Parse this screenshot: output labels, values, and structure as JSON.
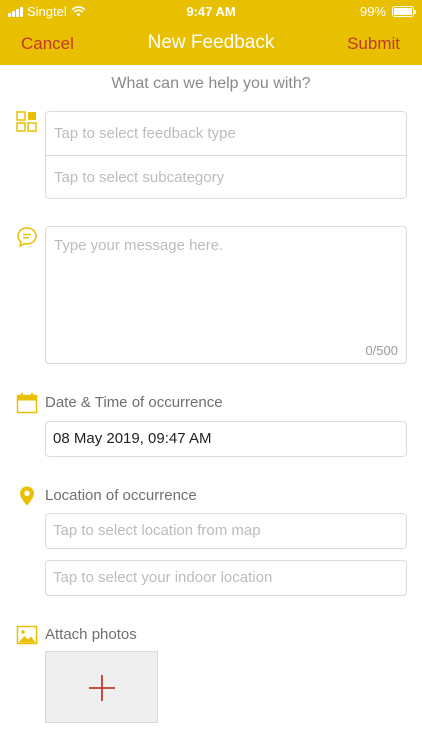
{
  "status_bar": {
    "carrier": "Singtel",
    "time": "9:47 AM",
    "battery": "99%"
  },
  "nav": {
    "cancel_label": "Cancel",
    "title": "New Feedback",
    "submit_label": "Submit"
  },
  "prompt": "What can we help you with?",
  "feedback_type": {
    "type_placeholder": "Tap to select feedback type",
    "subcategory_placeholder": "Tap to select subcategory"
  },
  "message": {
    "placeholder": "Type your message here.",
    "counter": "0/500"
  },
  "occurrence_time": {
    "label": "Date & Time of occurrence",
    "value": "08 May 2019, 09:47 AM"
  },
  "location": {
    "label": "Location of occurrence",
    "map_placeholder": "Tap to select location from map",
    "indoor_placeholder": "Tap to select your indoor location"
  },
  "photos": {
    "label": "Attach photos"
  },
  "colors": {
    "accent": "#e9c001",
    "action_text": "#c0392b",
    "placeholder": "#bcbcbc"
  },
  "icons": [
    "wifi-icon",
    "battery-icon",
    "grid-icon",
    "chat-bubble-icon",
    "calendar-icon",
    "location-pin-icon",
    "image-icon",
    "plus-icon"
  ]
}
